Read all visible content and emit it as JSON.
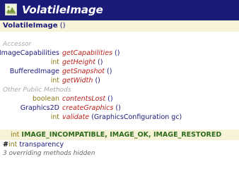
{
  "header": {
    "title": "VolatileImage",
    "icon": "class-image-icon"
  },
  "constructor": {
    "name": "VolatileImage",
    "args": "()"
  },
  "sections": {
    "accessor": "Accessor",
    "other_public": "Other Public Methods"
  },
  "accessor_methods": [
    {
      "type": "ImageCapabilities",
      "name": "getCapabilities",
      "args": "()"
    },
    {
      "type": "int",
      "name": "getHeight",
      "args": "()"
    },
    {
      "type": "BufferedImage",
      "name": "getSnapshot",
      "args": "()"
    },
    {
      "type": "int",
      "name": "getWidth",
      "args": "()"
    }
  ],
  "public_methods": [
    {
      "type": "boolean",
      "name": "contentsLost",
      "args": "()"
    },
    {
      "type": "Graphics2D",
      "name": "createGraphics",
      "args": "()"
    },
    {
      "type": "int",
      "name": "validate",
      "args": "(GraphicsConfiguration gc)"
    }
  ],
  "constants": {
    "type": "int",
    "names": "IMAGE_INCOMPATIBLE, IMAGE_OK, IMAGE_RESTORED"
  },
  "field": {
    "marker": "#",
    "type": "int",
    "name": "transparency"
  },
  "footer": {
    "count": "3",
    "text": "overriding methods hidden"
  },
  "colors": {
    "header_bg": "#1a1a78",
    "band_bg": "#f7f3d9",
    "method_name": "#b8201c",
    "class_type": "#1a1a78",
    "primitive_type": "#8a7a14",
    "constant": "#2c6a1c",
    "section_label": "#a8a8a8"
  }
}
